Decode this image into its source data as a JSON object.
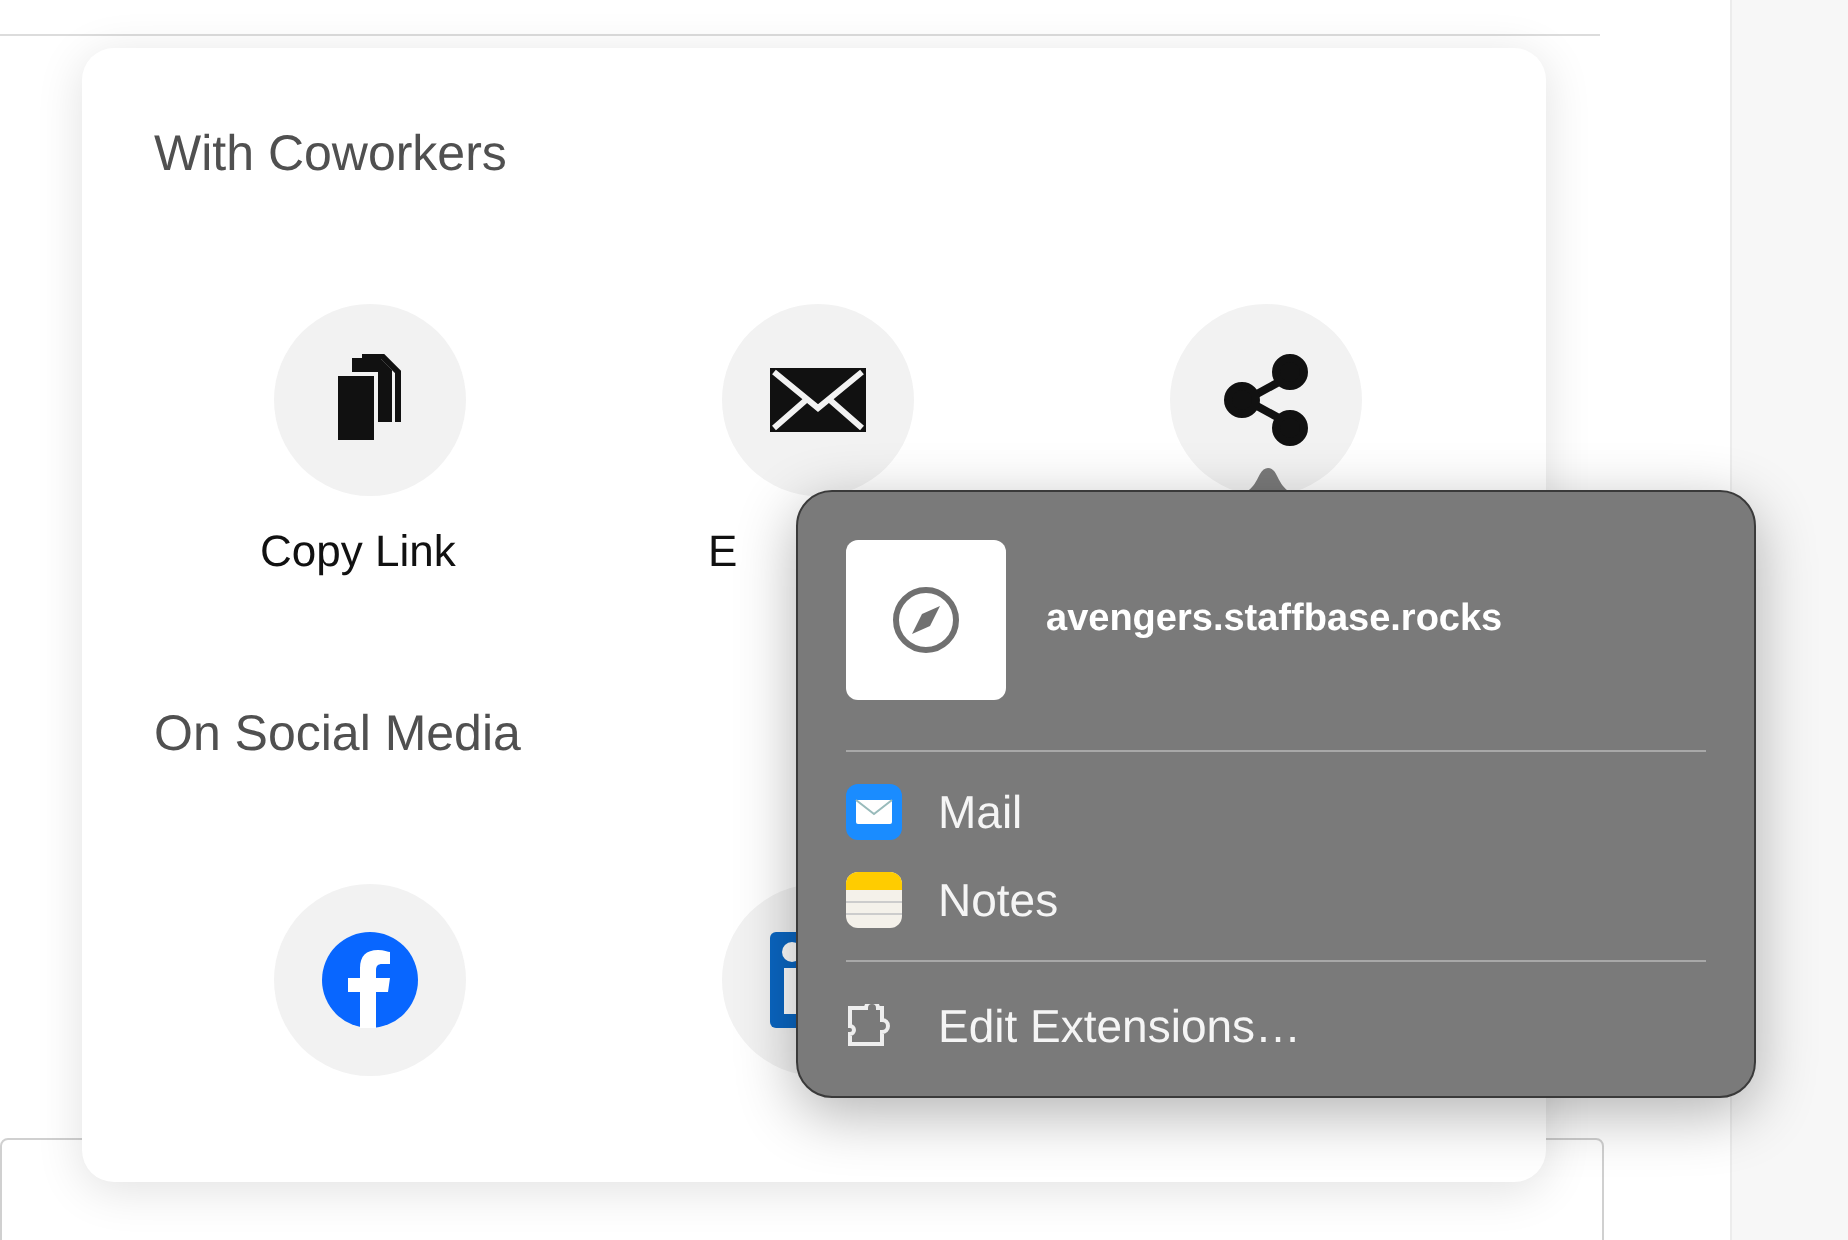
{
  "sections": [
    {
      "title": "With Coworkers",
      "actions": [
        {
          "kind": "copy",
          "label": "Copy Link"
        },
        {
          "kind": "email",
          "label": "E"
        },
        {
          "kind": "share"
        }
      ]
    },
    {
      "title": "On Social Media",
      "actions": [
        {
          "kind": "facebook"
        },
        {
          "kind": "linkedin"
        }
      ]
    }
  ],
  "share_menu": {
    "site": "avengers.staffbase.rocks",
    "apps": [
      {
        "kind": "mail",
        "label": "Mail"
      },
      {
        "kind": "notes",
        "label": "Notes"
      }
    ],
    "edit_label": "Edit Extensions…"
  }
}
